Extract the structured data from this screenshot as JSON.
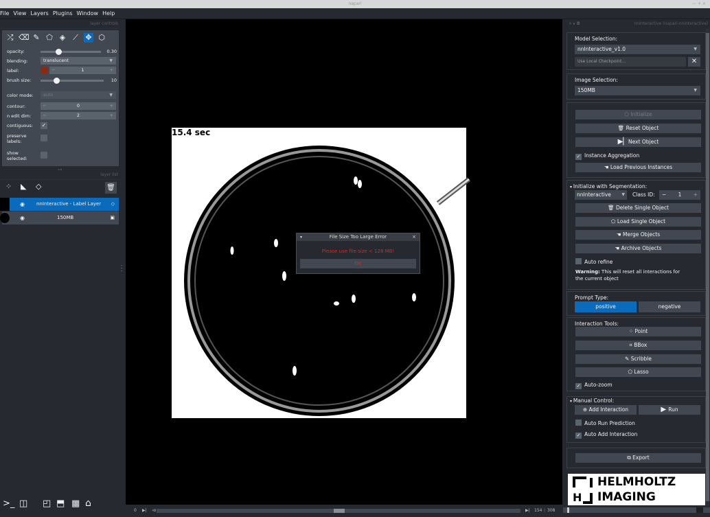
{
  "window": {
    "title": "napari",
    "controls": "— + ×"
  },
  "menu": [
    "File",
    "View",
    "Layers",
    "Plugins",
    "Window",
    "Help"
  ],
  "layer_controls": {
    "title": "layer controls",
    "opacity_label": "opacity:",
    "opacity_value": "0.30",
    "opacity_fraction": 0.3,
    "blending_label": "blending:",
    "blending_value": "translucent",
    "label_label": "label:",
    "label_value": "1",
    "label_color": "#8b2a10",
    "brush_label": "brush size:",
    "brush_value": "10",
    "brush_fraction": 0.25,
    "color_mode_label": "color mode:",
    "color_mode_value": "auto",
    "contour_label": "contour:",
    "contour_value": "0",
    "ndim_label": "n edit dim:",
    "ndim_value": "2",
    "contiguous_label": "contiguous:",
    "contiguous_checked": true,
    "preserve_label": "preserve labels:",
    "show_selected_label": "show selected:"
  },
  "layer_list": {
    "title": "layer list",
    "layers": [
      {
        "name": "nnInteractive - Label Layer",
        "selected": true
      },
      {
        "name": "150MB",
        "selected": false
      }
    ]
  },
  "viewer": {
    "overlay_text": "15.4 sec",
    "dim_start": "0",
    "dim_current": "154",
    "dim_total": "308"
  },
  "dialog": {
    "title": "File Size Too Large Error",
    "message": "Please use file size < 128 MB!",
    "ok": "OK"
  },
  "plugin": {
    "title": "nnInteractive (napari-nninteractive)",
    "model_selection_label": "Model Selection:",
    "model_value": "nnInteractive_v1.0",
    "local_checkpoint_placeholder": "Use Local Checkpoint...",
    "image_selection_label": "Image Selection:",
    "image_value": "150MB",
    "initialize": "Initialize",
    "reset_object": "Reset Object",
    "next_object": "Next Object",
    "instance_aggregation": "Instance Aggregation",
    "load_previous": "Load Previous Instances",
    "init_seg_label": "Initialize with Segmentation:",
    "seg_layer": "nnInteractive",
    "class_id_label": "Class ID:",
    "class_id": "1",
    "delete_single": "Delete Single Object",
    "load_single": "Load Single Object",
    "merge": "Merge Objects",
    "archive": "Archive Objects",
    "auto_refine": "Auto refine",
    "warning_bold": "Warning:",
    "warning_text": " This will reset all interactions for the current object",
    "prompt_type_label": "Prompt Type:",
    "positive": "positive",
    "negative": "negative",
    "interaction_tools_label": "Interaction Tools:",
    "point": "Point",
    "bbox": "BBox",
    "scribble": "Scribble",
    "lasso": "Lasso",
    "auto_zoom": "Auto-zoom",
    "manual_control_label": "Manual Control:",
    "add_interaction": "Add Interaction",
    "run": "Run",
    "auto_run": "Auto Run Prediction",
    "auto_add": "Auto Add Interaction",
    "export": "Export",
    "logo_line1": "HELMHOLTZ",
    "logo_line2": "IMAGING"
  },
  "colors": {
    "accent": "#0a6bbd",
    "error_red": "#e0261c",
    "panel": "#262930",
    "widget": "#414851"
  }
}
